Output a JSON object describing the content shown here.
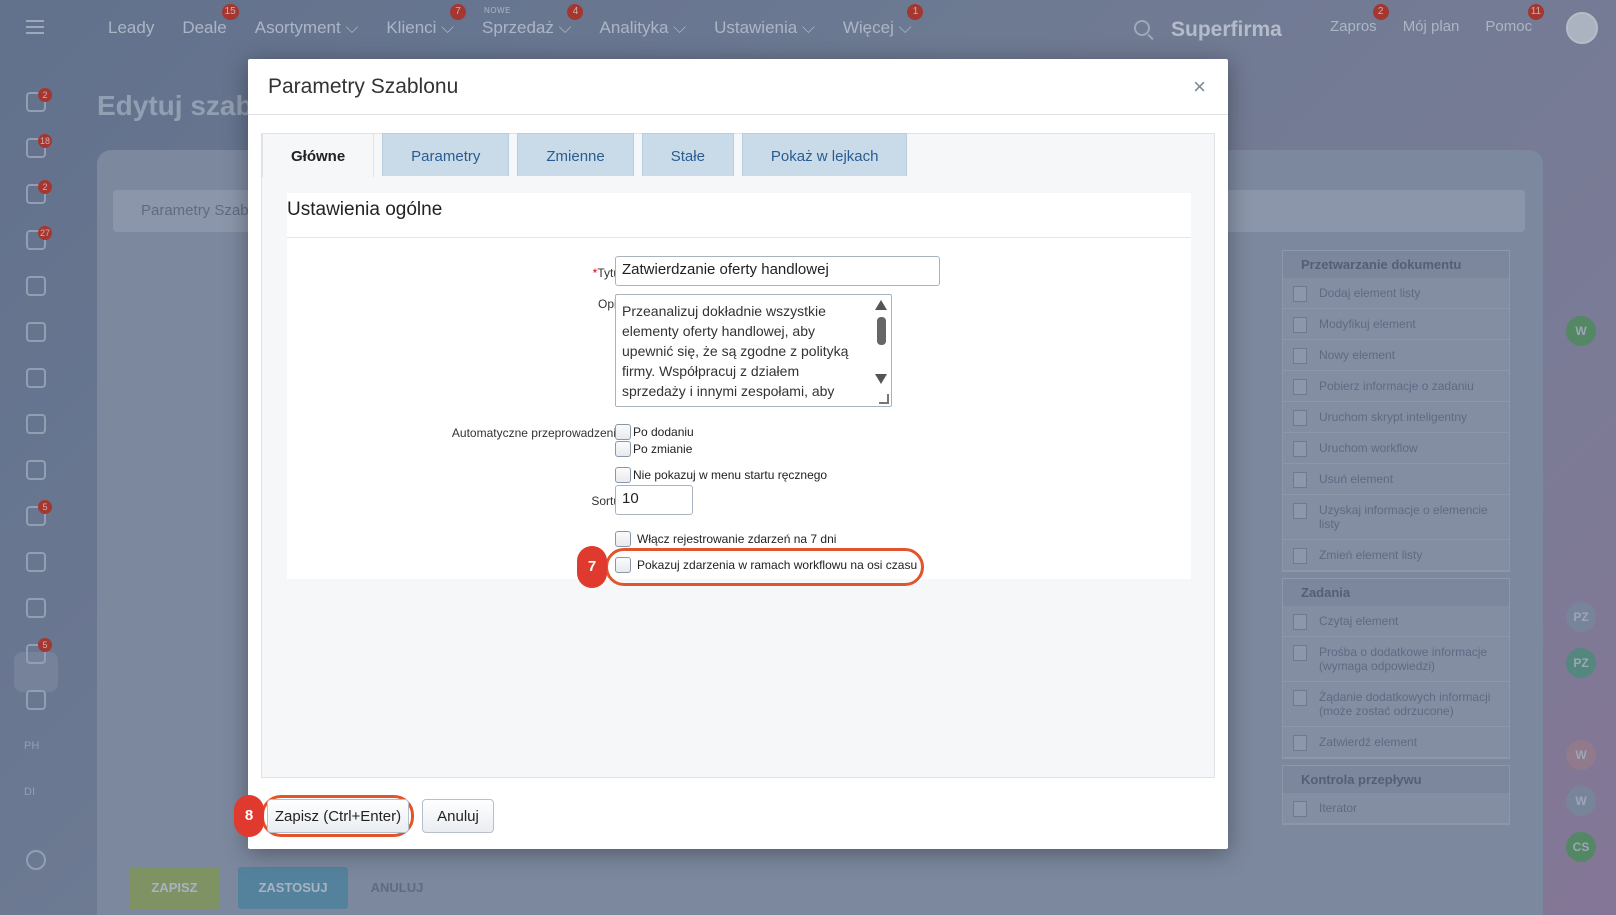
{
  "app": {
    "nav": [
      {
        "label": "Leady",
        "badge": ""
      },
      {
        "label": "Deale",
        "badge": "15"
      },
      {
        "label": "Asortyment ⌵",
        "badge": ""
      },
      {
        "label": "Klienci ⌵",
        "badge": "7"
      },
      {
        "label": "Sprzedaż ⌵",
        "badge": "4",
        "tag": "NOWE"
      },
      {
        "label": "Analityka ⌵",
        "badge": ""
      },
      {
        "label": "Ustawienia ⌵",
        "badge": ""
      },
      {
        "label": "Więcej ⌵",
        "badge": "1"
      }
    ],
    "brand": "Superfirma",
    "right_nav": [
      {
        "label": "Zapros",
        "badge": "2"
      },
      {
        "label": "Mój plan",
        "badge": ""
      },
      {
        "label": "Pomoc",
        "badge": "11"
      }
    ],
    "rail_badges": [
      "2",
      "18",
      "2",
      "27",
      "5",
      "5"
    ],
    "rail_texts": [
      "PH",
      "DI"
    ],
    "page_title": "Edytuj szabl",
    "panel_bar_label": "Parametry Szab",
    "bottom_buttons": {
      "save": "ZAPISZ",
      "apply": "ZASTOSUJ",
      "cancel": "ANULUJ"
    },
    "blocks": [
      {
        "title": "Przetwarzanie dokumentu",
        "items": [
          "Dodaj element listy",
          "Modyfikuj element",
          "Nowy element",
          "Pobierz informacje o zadaniu",
          "Uruchom skrypt inteligentny",
          "Uruchom workflow",
          "Usuń element",
          "Uzyskaj informacje o elemencie listy",
          "Zmień element listy"
        ]
      },
      {
        "title": "Zadania",
        "items": [
          "Czytaj element",
          "Prośba o dodatkowe informacje (wymaga odpowiedzi)",
          "Żądanie dodatkowych informacji (może zostać odrzucone)",
          "Zatwierdź element"
        ]
      },
      {
        "title": "Kontrola przepływu",
        "items": [
          "Iterator"
        ]
      }
    ],
    "right_rail": [
      "W",
      "PZ",
      "PZ",
      "W",
      "W",
      "CS"
    ]
  },
  "modal": {
    "title": "Parametry Szablonu",
    "close": "×",
    "tabs": [
      "Główne",
      "Parametry",
      "Zmienne",
      "Stałe",
      "Pokaż w lejkach"
    ],
    "section_title": "Ustawienia ogólne",
    "fields": {
      "title_label": "Tytuł:",
      "title_required": "*",
      "title_value": "Zatwierdzanie oferty handlowej",
      "desc_label": "Opis:",
      "desc_value": "Przeanalizuj dokładnie wszystkie elementy oferty handlowej, aby upewnić się, że są zgodne z polityką firmy. Współpracuj z działem sprzedaży i innymi zespołami, aby",
      "auto_label": "Automatyczne przeprowadzenie:",
      "auto_on_add": "Po dodaniu",
      "auto_on_change": "Po zmianie",
      "hide_manual": "Nie pokazuj w menu startu ręcznego",
      "sort_label": "Sortuj:",
      "sort_value": "10",
      "enable_logging": "Włącz rejestrowanie zdarzeń na 7 dni",
      "show_timeline": "Pokazuj zdarzenia w ramach workflowu na osi czasu"
    },
    "steps": {
      "timeline": "7",
      "save": "8"
    },
    "buttons": {
      "save": "Zapisz (Ctrl+Enter)",
      "cancel": "Anuluj"
    }
  }
}
